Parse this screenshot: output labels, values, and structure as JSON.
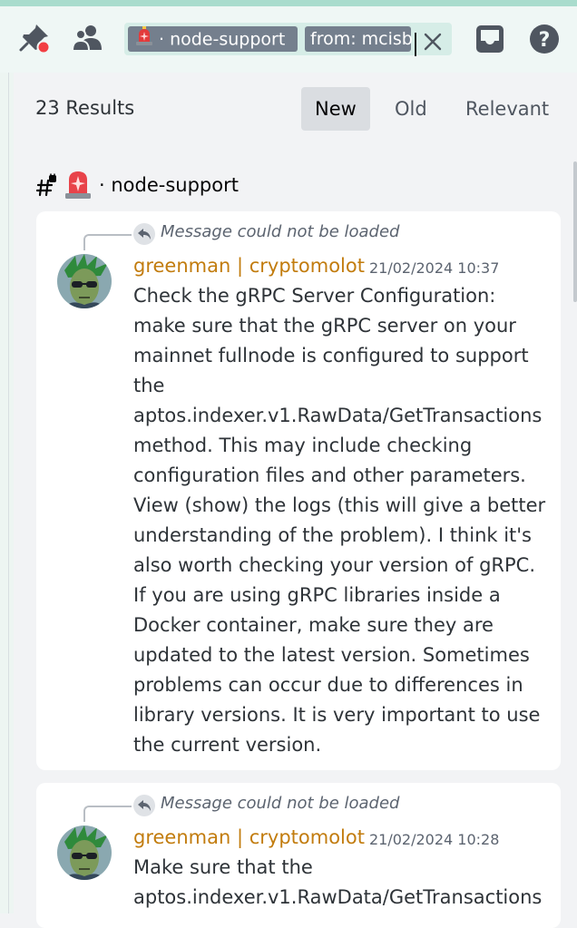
{
  "toolbar": {
    "search_chip_channel": "· node-support",
    "search_chip_from": "from: mcisb"
  },
  "results": {
    "count_label": "23 Results",
    "sort_options": [
      "New",
      "Old",
      "Relevant"
    ],
    "active_sort": "New"
  },
  "channel": {
    "name": "· node-support"
  },
  "messages": [
    {
      "reply_text": "Message could not be loaded",
      "author": "greenman | cryptomolot",
      "timestamp": "21/02/2024 10:37",
      "lines": [
        "Check the gRPC Server Configuration:",
        "make sure that the gRPC server on your",
        "mainnet fullnode is configured to support",
        "the",
        "aptos.indexer.v1.RawData/GetTransactions",
        "method. This may include checking",
        "configuration files and other parameters.",
        "View (show) the logs (this will give a better",
        "understanding of the problem). I think it's",
        "also worth checking your version of gRPC.",
        "If you are using gRPC libraries inside a",
        "Docker container, make sure they are",
        "updated to the latest version. Sometimes",
        "problems can occur due to differences in",
        "library versions. It is very important to use",
        "the current version."
      ]
    },
    {
      "reply_text": "Message could not be loaded",
      "author": "greenman | cryptomolot",
      "timestamp": "21/02/2024 10:28",
      "lines": [
        "Make sure that the",
        "aptos.indexer.v1.RawData/GetTransactions"
      ]
    }
  ],
  "colors": {
    "accent_bar": "#a9dccd",
    "author": "#c27c0e",
    "chip_bg": "#747f8d"
  },
  "icons": [
    "pin-icon",
    "members-icon",
    "siren-icon",
    "close-icon",
    "inbox-icon",
    "help-icon",
    "reply-arrow-icon",
    "channel-hash-icon"
  ]
}
